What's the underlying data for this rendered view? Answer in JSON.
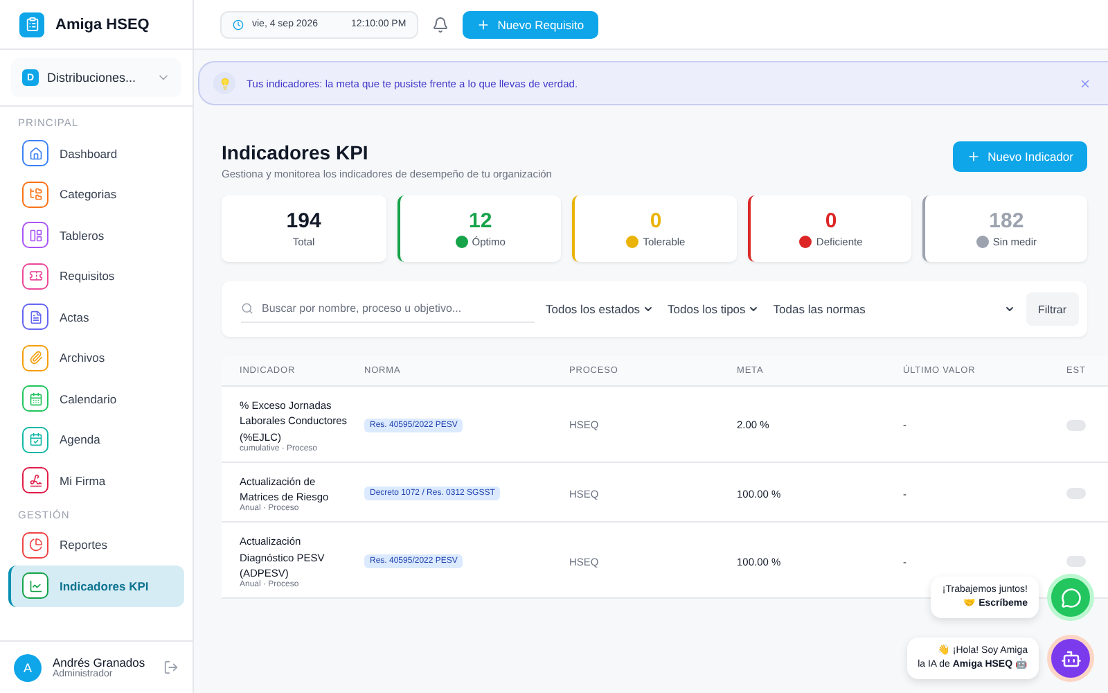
{
  "app": {
    "name": "Amiga HSEQ"
  },
  "topbar": {
    "date": "vie, 4 sep 2026",
    "time": "12:10:00 PM",
    "new_button": "Nuevo Requisito"
  },
  "org": {
    "initial": "D",
    "name": "Distribuciones..."
  },
  "sidebar": {
    "sections": [
      {
        "title": "PRINCIPAL",
        "items": [
          {
            "label": "Dashboard",
            "color": "#3b82f6",
            "selected": false
          },
          {
            "label": "Categorias",
            "color": "#f97316",
            "selected": false
          },
          {
            "label": "Tableros",
            "color": "#a855f7",
            "selected": false
          },
          {
            "label": "Requisitos",
            "color": "#ec4899",
            "selected": false
          },
          {
            "label": "Actas",
            "color": "#6366f1",
            "selected": false
          },
          {
            "label": "Archivos",
            "color": "#f59e0b",
            "selected": false
          },
          {
            "label": "Calendario",
            "color": "#22c55e",
            "selected": false
          },
          {
            "label": "Agenda",
            "color": "#14b8a6",
            "selected": false
          },
          {
            "label": "Mi Firma",
            "color": "#e11d48",
            "selected": false
          }
        ]
      },
      {
        "title": "GESTIÓN",
        "items": [
          {
            "label": "Reportes",
            "color": "#ef4444",
            "selected": false
          },
          {
            "label": "Indicadores KPI",
            "color": "#16a34a",
            "selected": true
          }
        ]
      }
    ]
  },
  "user": {
    "initial": "A",
    "name": "Andrés Granados",
    "role": "Administrador"
  },
  "banner": {
    "text": "Tus indicadores: la meta que te pusiste frente a lo que llevas de verdad."
  },
  "page": {
    "title": "Indicadores KPI",
    "subtitle": "Gestiona y monitorea los indicadores de desempeño de tu organización",
    "new_button": "Nuevo Indicador"
  },
  "stats": [
    {
      "value": "194",
      "label": "Total",
      "kind": "total",
      "color": "#111827"
    },
    {
      "value": "12",
      "label": "Óptimo",
      "kind": "status",
      "color": "#16a34a"
    },
    {
      "value": "0",
      "label": "Tolerable",
      "kind": "status",
      "color": "#eab308"
    },
    {
      "value": "0",
      "label": "Deficiente",
      "kind": "status",
      "color": "#dc2626"
    },
    {
      "value": "182",
      "label": "Sin medir",
      "kind": "status",
      "color": "#9ca3af"
    }
  ],
  "filters": {
    "search_placeholder": "Buscar por nombre, proceso u objetivo...",
    "selects": [
      "Todos los estados",
      "Todos los tipos",
      "Todas las normas"
    ],
    "button": "Filtrar"
  },
  "table": {
    "columns": [
      "INDICADOR",
      "NORMA",
      "PROCESO",
      "META",
      "ÚLTIMO VALOR",
      "EST"
    ],
    "rows": [
      {
        "name": "% Exceso Jornadas Laborales Conductores (%EJLC)",
        "meta_line": "cumulative · Proceso",
        "norma": "Res. 40595/2022 PESV",
        "proceso": "HSEQ",
        "meta": "2.00 %",
        "ultimo": "-"
      },
      {
        "name": "Actualización de Matrices de Riesgo",
        "meta_line": "Anual · Proceso",
        "norma": "Decreto 1072 / Res. 0312 SGSST",
        "proceso": "HSEQ",
        "meta": "100.00 %",
        "ultimo": "-"
      },
      {
        "name": "Actualización Diagnóstico PESV (ADPESV)",
        "meta_line": "Anual · Proceso",
        "norma": "Res. 40595/2022 PESV",
        "proceso": "HSEQ",
        "meta": "100.00 %",
        "ultimo": "-"
      }
    ]
  },
  "chat": [
    {
      "kind": "whatsapp",
      "line1": "¡Trabajemos juntos!",
      "line2": "🤝 **Escríbeme**"
    },
    {
      "kind": "bot",
      "line1": "👋 ¡Hola! Soy Amiga",
      "line2": "la IA de **Amiga HSEQ** 🤖"
    }
  ]
}
